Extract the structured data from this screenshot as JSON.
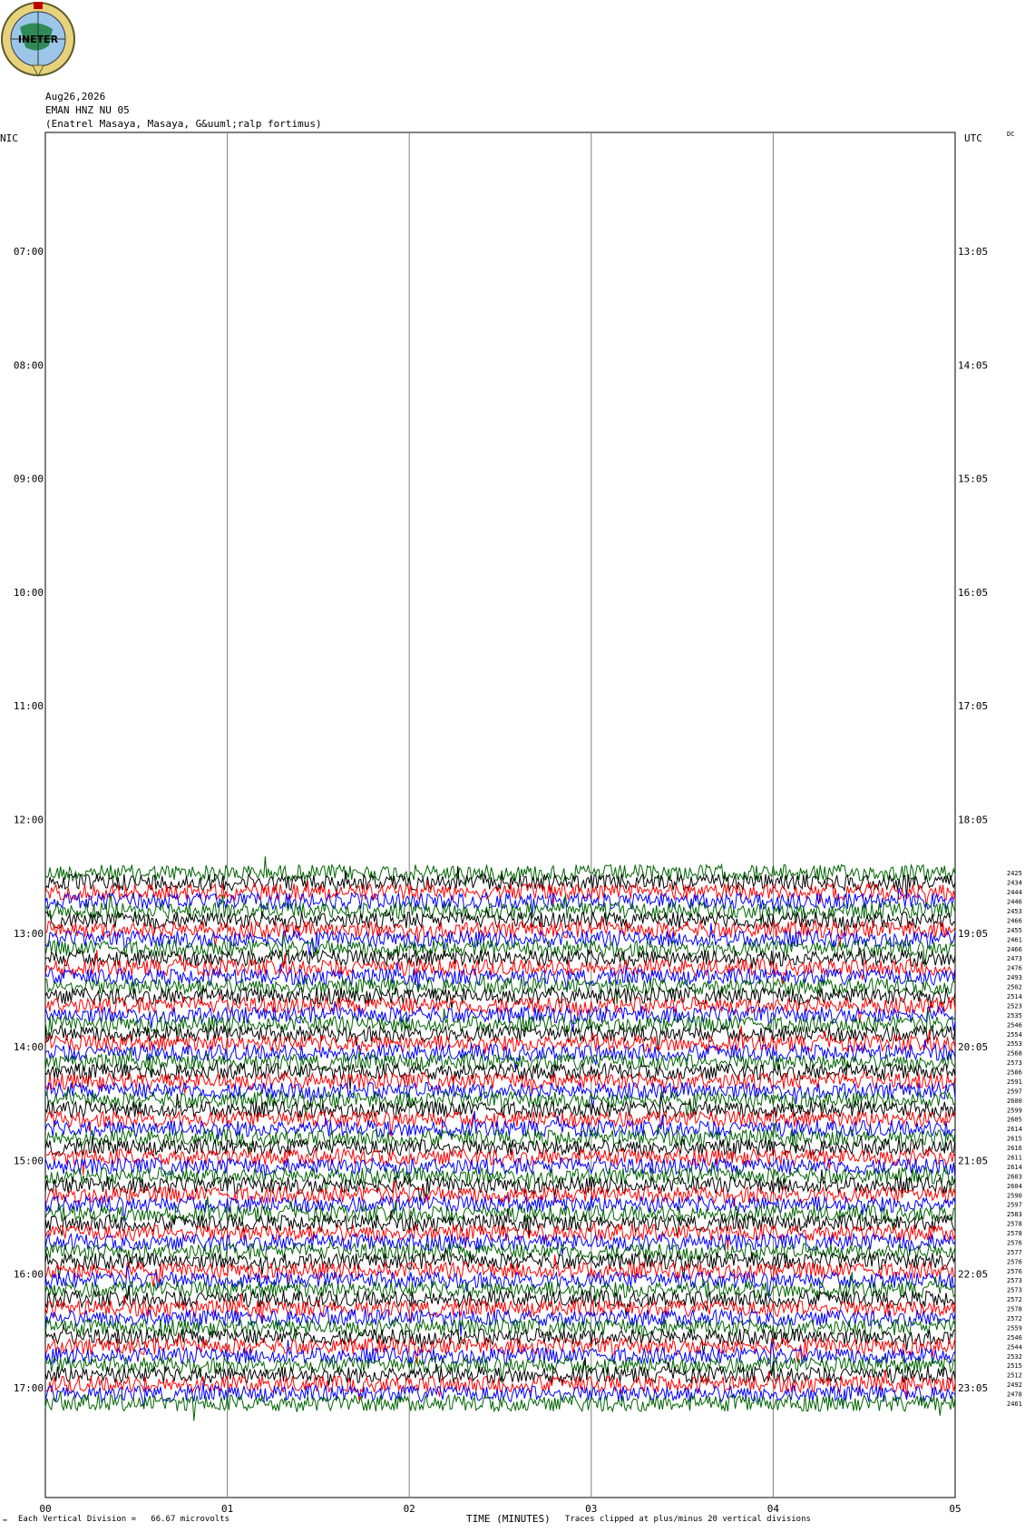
{
  "header": {
    "date": "Aug26,2026",
    "station": "EMAN HNZ NU 05",
    "location": "(Enatrel Masaya, Masaya, G&uuml;ralp fortimus)",
    "logo_text": "INETER"
  },
  "labels": {
    "left_zone": "NIC",
    "right_zone": "UTC",
    "dc": "DC",
    "corner_mark": "℠"
  },
  "footer": {
    "scale": "Each Vertical Division =   66.67 microvolts",
    "xlabel": "TIME (MINUTES)",
    "clip_note": "Traces clipped at plus/minus 20 vertical divisions"
  },
  "colors": {
    "trace_cycle": [
      "#006400",
      "#000000",
      "#ff0000",
      "#0000ff"
    ],
    "grid": "#808080",
    "logo_gold": "#e6d27a",
    "logo_blue": "#9cc6e8",
    "logo_green": "#2e8b57"
  },
  "chart_data": {
    "type": "seismogram_helicorder",
    "x": {
      "label": "TIME (MINUTES)",
      "ticks": [
        "00",
        "01",
        "02",
        "03",
        "04",
        "05"
      ],
      "range": [
        0,
        5
      ]
    },
    "y_left_ticks": [
      "07:00",
      "08:00",
      "09:00",
      "10:00",
      "11:00",
      "12:00",
      "13:00",
      "14:00",
      "15:00",
      "16:00",
      "17:00"
    ],
    "y_right_ticks": [
      "13:05",
      "14:05",
      "15:05",
      "16:05",
      "17:05",
      "18:05",
      "19:05",
      "20:05",
      "21:05",
      "22:05",
      "23:05"
    ],
    "rows_per_hour": 12,
    "first_trace_row": 85,
    "trace_values": [
      2425,
      2434,
      2444,
      2446,
      2453,
      2466,
      2455,
      2461,
      2466,
      2473,
      2476,
      2493,
      2502,
      2514,
      2523,
      2535,
      2546,
      2554,
      2553,
      2568,
      2573,
      2586,
      2591,
      2597,
      2600,
      2599,
      2605,
      2614,
      2615,
      2616,
      2611,
      2614,
      2603,
      2604,
      2590,
      2597,
      2583,
      2578,
      2578,
      2576,
      2577,
      2576,
      2576,
      2573,
      2573,
      2572,
      2578,
      2572,
      2559,
      2546,
      2544,
      2532,
      2515,
      2512,
      2492,
      2478,
      2461
    ]
  }
}
